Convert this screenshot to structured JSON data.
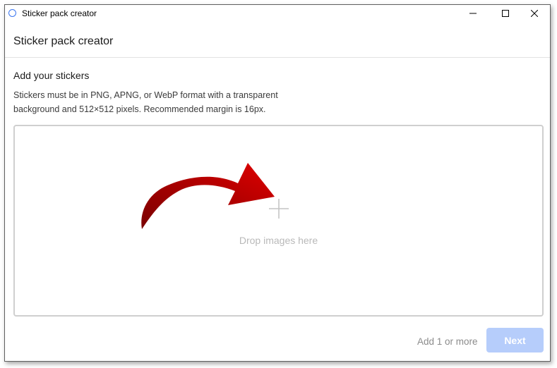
{
  "window": {
    "title": "Sticker pack creator"
  },
  "header": {
    "title": "Sticker pack creator"
  },
  "content": {
    "section_title": "Add your stickers",
    "description_line1": "Stickers must be in PNG, APNG, or WebP format with a transparent",
    "description_line2": "background and 512×512 pixels. Recommended margin is 16px."
  },
  "dropzone": {
    "hint": "Drop images here"
  },
  "footer": {
    "hint": "Add 1 or more",
    "next_label": "Next"
  },
  "colors": {
    "accent_disabled": "#b6cdfb",
    "app_icon": "#3a76f0",
    "arrow": "#c00000"
  },
  "icons": [
    "app-icon",
    "minimize-icon",
    "maximize-icon",
    "close-icon",
    "plus-icon",
    "red-arrow-annotation"
  ]
}
